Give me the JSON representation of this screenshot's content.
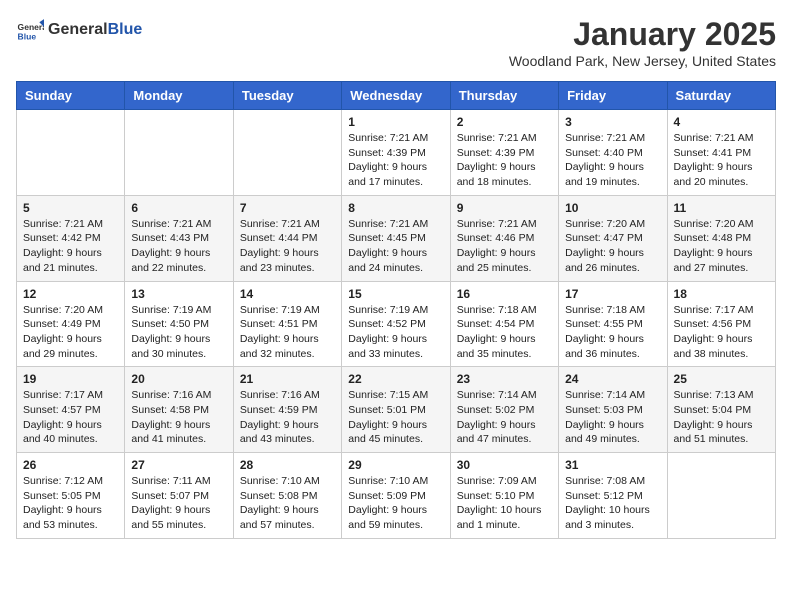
{
  "logo": {
    "general": "General",
    "blue": "Blue"
  },
  "title": "January 2025",
  "location": "Woodland Park, New Jersey, United States",
  "days_of_week": [
    "Sunday",
    "Monday",
    "Tuesday",
    "Wednesday",
    "Thursday",
    "Friday",
    "Saturday"
  ],
  "weeks": [
    [
      {
        "day": "",
        "info": ""
      },
      {
        "day": "",
        "info": ""
      },
      {
        "day": "",
        "info": ""
      },
      {
        "day": "1",
        "info": "Sunrise: 7:21 AM\nSunset: 4:39 PM\nDaylight: 9 hours\nand 17 minutes."
      },
      {
        "day": "2",
        "info": "Sunrise: 7:21 AM\nSunset: 4:39 PM\nDaylight: 9 hours\nand 18 minutes."
      },
      {
        "day": "3",
        "info": "Sunrise: 7:21 AM\nSunset: 4:40 PM\nDaylight: 9 hours\nand 19 minutes."
      },
      {
        "day": "4",
        "info": "Sunrise: 7:21 AM\nSunset: 4:41 PM\nDaylight: 9 hours\nand 20 minutes."
      }
    ],
    [
      {
        "day": "5",
        "info": "Sunrise: 7:21 AM\nSunset: 4:42 PM\nDaylight: 9 hours\nand 21 minutes."
      },
      {
        "day": "6",
        "info": "Sunrise: 7:21 AM\nSunset: 4:43 PM\nDaylight: 9 hours\nand 22 minutes."
      },
      {
        "day": "7",
        "info": "Sunrise: 7:21 AM\nSunset: 4:44 PM\nDaylight: 9 hours\nand 23 minutes."
      },
      {
        "day": "8",
        "info": "Sunrise: 7:21 AM\nSunset: 4:45 PM\nDaylight: 9 hours\nand 24 minutes."
      },
      {
        "day": "9",
        "info": "Sunrise: 7:21 AM\nSunset: 4:46 PM\nDaylight: 9 hours\nand 25 minutes."
      },
      {
        "day": "10",
        "info": "Sunrise: 7:20 AM\nSunset: 4:47 PM\nDaylight: 9 hours\nand 26 minutes."
      },
      {
        "day": "11",
        "info": "Sunrise: 7:20 AM\nSunset: 4:48 PM\nDaylight: 9 hours\nand 27 minutes."
      }
    ],
    [
      {
        "day": "12",
        "info": "Sunrise: 7:20 AM\nSunset: 4:49 PM\nDaylight: 9 hours\nand 29 minutes."
      },
      {
        "day": "13",
        "info": "Sunrise: 7:19 AM\nSunset: 4:50 PM\nDaylight: 9 hours\nand 30 minutes."
      },
      {
        "day": "14",
        "info": "Sunrise: 7:19 AM\nSunset: 4:51 PM\nDaylight: 9 hours\nand 32 minutes."
      },
      {
        "day": "15",
        "info": "Sunrise: 7:19 AM\nSunset: 4:52 PM\nDaylight: 9 hours\nand 33 minutes."
      },
      {
        "day": "16",
        "info": "Sunrise: 7:18 AM\nSunset: 4:54 PM\nDaylight: 9 hours\nand 35 minutes."
      },
      {
        "day": "17",
        "info": "Sunrise: 7:18 AM\nSunset: 4:55 PM\nDaylight: 9 hours\nand 36 minutes."
      },
      {
        "day": "18",
        "info": "Sunrise: 7:17 AM\nSunset: 4:56 PM\nDaylight: 9 hours\nand 38 minutes."
      }
    ],
    [
      {
        "day": "19",
        "info": "Sunrise: 7:17 AM\nSunset: 4:57 PM\nDaylight: 9 hours\nand 40 minutes."
      },
      {
        "day": "20",
        "info": "Sunrise: 7:16 AM\nSunset: 4:58 PM\nDaylight: 9 hours\nand 41 minutes."
      },
      {
        "day": "21",
        "info": "Sunrise: 7:16 AM\nSunset: 4:59 PM\nDaylight: 9 hours\nand 43 minutes."
      },
      {
        "day": "22",
        "info": "Sunrise: 7:15 AM\nSunset: 5:01 PM\nDaylight: 9 hours\nand 45 minutes."
      },
      {
        "day": "23",
        "info": "Sunrise: 7:14 AM\nSunset: 5:02 PM\nDaylight: 9 hours\nand 47 minutes."
      },
      {
        "day": "24",
        "info": "Sunrise: 7:14 AM\nSunset: 5:03 PM\nDaylight: 9 hours\nand 49 minutes."
      },
      {
        "day": "25",
        "info": "Sunrise: 7:13 AM\nSunset: 5:04 PM\nDaylight: 9 hours\nand 51 minutes."
      }
    ],
    [
      {
        "day": "26",
        "info": "Sunrise: 7:12 AM\nSunset: 5:05 PM\nDaylight: 9 hours\nand 53 minutes."
      },
      {
        "day": "27",
        "info": "Sunrise: 7:11 AM\nSunset: 5:07 PM\nDaylight: 9 hours\nand 55 minutes."
      },
      {
        "day": "28",
        "info": "Sunrise: 7:10 AM\nSunset: 5:08 PM\nDaylight: 9 hours\nand 57 minutes."
      },
      {
        "day": "29",
        "info": "Sunrise: 7:10 AM\nSunset: 5:09 PM\nDaylight: 9 hours\nand 59 minutes."
      },
      {
        "day": "30",
        "info": "Sunrise: 7:09 AM\nSunset: 5:10 PM\nDaylight: 10 hours\nand 1 minute."
      },
      {
        "day": "31",
        "info": "Sunrise: 7:08 AM\nSunset: 5:12 PM\nDaylight: 10 hours\nand 3 minutes."
      },
      {
        "day": "",
        "info": ""
      }
    ]
  ]
}
